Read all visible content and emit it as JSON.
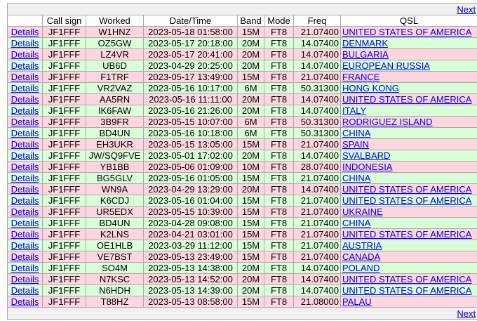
{
  "nav": {
    "next_label": "Next"
  },
  "headers": [
    "",
    "Call sign",
    "Worked",
    "Date/Time",
    "Band",
    "Mode",
    "Freq",
    "QSL"
  ],
  "details_label": "Details",
  "colors": {
    "row_pink": "#ffd6df",
    "row_green": "#d8ffd8",
    "link": "#0000ee"
  },
  "rows": [
    {
      "call": "JF1FFF",
      "worked": "W1HNZ",
      "datetime": "2023-05-18 01:58:00",
      "band": "15M",
      "mode": "FT8",
      "freq": "21.07400",
      "qsl": "UNITED STATES OF AMERICA"
    },
    {
      "call": "JF1FFF",
      "worked": "OZ5GW",
      "datetime": "2023-05-17 20:18:00",
      "band": "20M",
      "mode": "FT8",
      "freq": "14.07400",
      "qsl": "DENMARK"
    },
    {
      "call": "JF1FFF",
      "worked": "LZ4VR",
      "datetime": "2023-05-17 20:41:00",
      "band": "20M",
      "mode": "FT8",
      "freq": "14.07400",
      "qsl": "BULGARIA"
    },
    {
      "call": "JF1FFF",
      "worked": "UB6D",
      "datetime": "2023-04-29 20:25:00",
      "band": "20M",
      "mode": "FT8",
      "freq": "14.07400",
      "qsl": "EUROPEAN RUSSIA"
    },
    {
      "call": "JF1FFF",
      "worked": "F1TRF",
      "datetime": "2023-05-17 13:49:00",
      "band": "15M",
      "mode": "FT8",
      "freq": "21.07400",
      "qsl": "FRANCE"
    },
    {
      "call": "JF1FFF",
      "worked": "VR2VAZ",
      "datetime": "2023-05-16 10:17:00",
      "band": "6M",
      "mode": "FT8",
      "freq": "50.31300",
      "qsl": "HONG KONG"
    },
    {
      "call": "JF1FFF",
      "worked": "AA5RN",
      "datetime": "2023-05-16 11:11:00",
      "band": "20M",
      "mode": "FT8",
      "freq": "14.07400",
      "qsl": "UNITED STATES OF AMERICA"
    },
    {
      "call": "JF1FFF",
      "worked": "IK6FAW",
      "datetime": "2023-05-16 21:26:00",
      "band": "20M",
      "mode": "FT8",
      "freq": "14.07400",
      "qsl": "ITALY"
    },
    {
      "call": "JF1FFF",
      "worked": "3B9FR",
      "datetime": "2023-05-15 10:07:00",
      "band": "6M",
      "mode": "FT8",
      "freq": "50.31300",
      "qsl": "RODRIGUEZ ISLAND"
    },
    {
      "call": "JF1FFF",
      "worked": "BD4UN",
      "datetime": "2023-05-16 10:18:00",
      "band": "6M",
      "mode": "FT8",
      "freq": "50.31300",
      "qsl": "CHINA"
    },
    {
      "call": "JF1FFF",
      "worked": "EH3UKR",
      "datetime": "2023-05-15 13:05:00",
      "band": "15M",
      "mode": "FT8",
      "freq": "21.07400",
      "qsl": "SPAIN"
    },
    {
      "call": "JF1FFF",
      "worked": "JW/SQ9FVE",
      "datetime": "2023-05-01 17:02:00",
      "band": "20M",
      "mode": "FT8",
      "freq": "14.07400",
      "qsl": "SVALBARD"
    },
    {
      "call": "JF1FFF",
      "worked": "YB1BB",
      "datetime": "2023-05-06 01:09:00",
      "band": "10M",
      "mode": "FT8",
      "freq": "28.07400",
      "qsl": "INDONESIA"
    },
    {
      "call": "JF1FFF",
      "worked": "BG5GLV",
      "datetime": "2023-05-16 01:05:00",
      "band": "15M",
      "mode": "FT8",
      "freq": "21.07400",
      "qsl": "CHINA"
    },
    {
      "call": "JF1FFF",
      "worked": "WN9A",
      "datetime": "2023-04-29 13:29:00",
      "band": "20M",
      "mode": "FT8",
      "freq": "14.07400",
      "qsl": "UNITED STATES OF AMERICA"
    },
    {
      "call": "JF1FFF",
      "worked": "K6CDJ",
      "datetime": "2023-05-16 01:04:00",
      "band": "15M",
      "mode": "FT8",
      "freq": "21.07400",
      "qsl": "UNITED STATES OF AMERICA"
    },
    {
      "call": "JF1FFF",
      "worked": "UR5EDX",
      "datetime": "2023-05-15 10:39:00",
      "band": "15M",
      "mode": "FT8",
      "freq": "21.07400",
      "qsl": "UKRAINE"
    },
    {
      "call": "JF1FFF",
      "worked": "BD4UN",
      "datetime": "2023-04-28 09:08:00",
      "band": "15M",
      "mode": "FT8",
      "freq": "21.07400",
      "qsl": "CHINA"
    },
    {
      "call": "JF1FFF",
      "worked": "K2LNS",
      "datetime": "2023-04-21 03:01:00",
      "band": "15M",
      "mode": "FT8",
      "freq": "21.07400",
      "qsl": "UNITED STATES OF AMERICA"
    },
    {
      "call": "JF1FFF",
      "worked": "OE1HLB",
      "datetime": "2023-03-29 11:12:00",
      "band": "15M",
      "mode": "FT8",
      "freq": "21.07400",
      "qsl": "AUSTRIA"
    },
    {
      "call": "JF1FFF",
      "worked": "VE7BST",
      "datetime": "2023-05-13 23:49:00",
      "band": "15M",
      "mode": "FT8",
      "freq": "21.07400",
      "qsl": "CANADA"
    },
    {
      "call": "JF1FFF",
      "worked": "SO4M",
      "datetime": "2023-05-13 14:38:00",
      "band": "20M",
      "mode": "FT8",
      "freq": "14.07400",
      "qsl": "POLAND"
    },
    {
      "call": "JF1FFF",
      "worked": "N7KSC",
      "datetime": "2023-05-13 14:52:00",
      "band": "20M",
      "mode": "FT8",
      "freq": "14.07400",
      "qsl": "UNITED STATES OF AMERICA"
    },
    {
      "call": "JF1FFF",
      "worked": "N6HDH",
      "datetime": "2023-05-13 14:39:00",
      "band": "20M",
      "mode": "FT8",
      "freq": "14.07400",
      "qsl": "UNITED STATES OF AMERICA"
    },
    {
      "call": "JF1FFF",
      "worked": "T88HZ",
      "datetime": "2023-05-13 08:58:00",
      "band": "15M",
      "mode": "FT8",
      "freq": "21.08000",
      "qsl": "PALAU"
    }
  ]
}
